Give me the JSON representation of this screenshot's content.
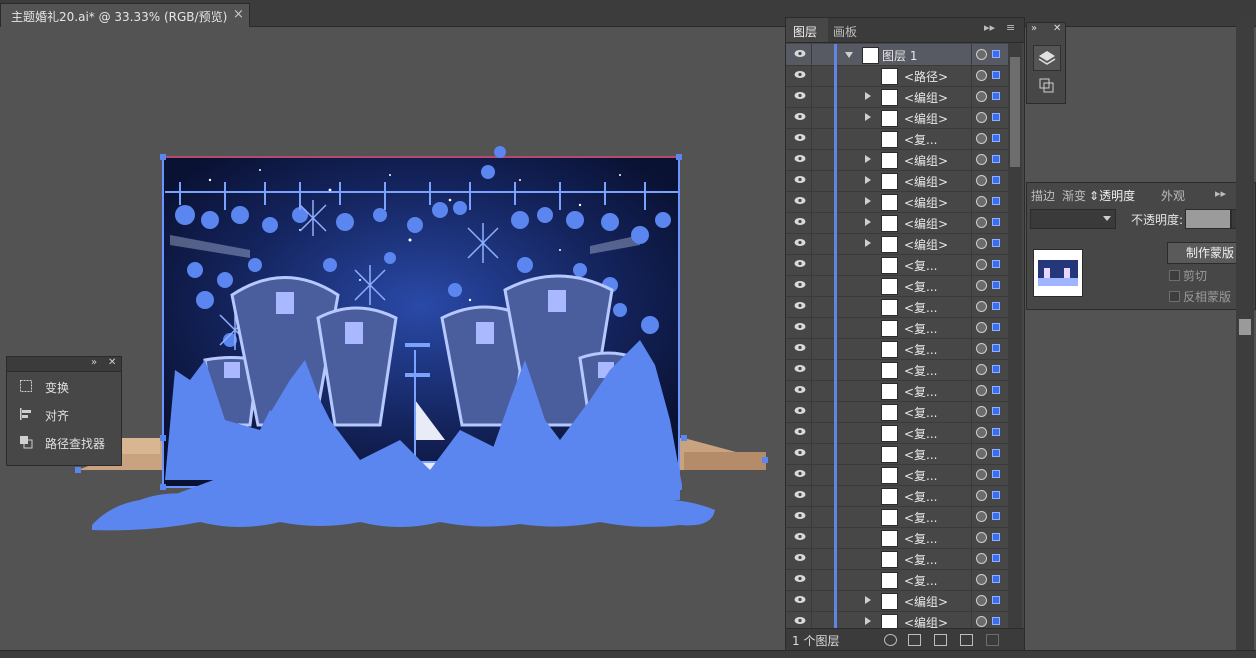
{
  "document": {
    "tab_title": "主题婚礼20.ai* @ 33.33% (RGB/预览)",
    "close_glyph": "×"
  },
  "colors": {
    "selection": "#5b86f0",
    "panel": "#474747",
    "canvas": "#535353"
  },
  "float_panel": {
    "items": [
      {
        "label": "变换",
        "icon": "transform-icon"
      },
      {
        "label": "对齐",
        "icon": "align-icon"
      },
      {
        "label": "路径查找器",
        "icon": "pathfinder-icon"
      }
    ]
  },
  "layers_panel": {
    "tabs": [
      "图层",
      "画板"
    ],
    "top_layer": "图层 1",
    "rows": [
      {
        "name": "<路径>",
        "expand": false
      },
      {
        "name": "<编组>",
        "expand": true
      },
      {
        "name": "<编组>",
        "expand": true
      },
      {
        "name": "<复...",
        "expand": false
      },
      {
        "name": "<编组>",
        "expand": true
      },
      {
        "name": "<编组>",
        "expand": true
      },
      {
        "name": "<编组>",
        "expand": true
      },
      {
        "name": "<编组>",
        "expand": true
      },
      {
        "name": "<编组>",
        "expand": true
      },
      {
        "name": "<复...",
        "expand": false
      },
      {
        "name": "<复...",
        "expand": false
      },
      {
        "name": "<复...",
        "expand": false
      },
      {
        "name": "<复...",
        "expand": false
      },
      {
        "name": "<复...",
        "expand": false
      },
      {
        "name": "<复...",
        "expand": false
      },
      {
        "name": "<复...",
        "expand": false
      },
      {
        "name": "<复...",
        "expand": false
      },
      {
        "name": "<复...",
        "expand": false
      },
      {
        "name": "<复...",
        "expand": false
      },
      {
        "name": "<复...",
        "expand": false
      },
      {
        "name": "<复...",
        "expand": false
      },
      {
        "name": "<复...",
        "expand": false
      },
      {
        "name": "<复...",
        "expand": false
      },
      {
        "name": "<复...",
        "expand": false
      },
      {
        "name": "<复...",
        "expand": false
      },
      {
        "name": "<编组>",
        "expand": true
      },
      {
        "name": "<编组>",
        "expand": true
      }
    ],
    "footer_count": "1 个图层"
  },
  "transparency_panel": {
    "tabs": [
      "描边",
      "渐变",
      "透明度",
      "外观"
    ],
    "opacity_label": "不透明度:",
    "make_mask": "制作蒙版",
    "clip": "剪切",
    "invert_mask": "反相蒙版"
  }
}
